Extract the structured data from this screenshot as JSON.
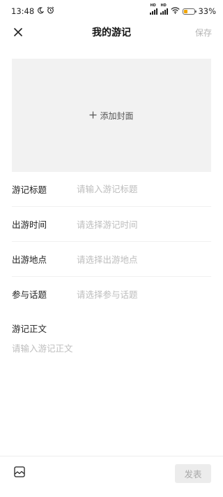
{
  "status_bar": {
    "time": "13:48",
    "battery_text": "33%",
    "battery_level": 0.33,
    "network_badge": "HD"
  },
  "header": {
    "title": "我的游记",
    "save_label": "保存"
  },
  "cover": {
    "add_label": "添加封面"
  },
  "form": {
    "title": {
      "label": "游记标题",
      "placeholder": "请输入游记标题"
    },
    "time": {
      "label": "出游时间",
      "placeholder": "请选择游记时间"
    },
    "place": {
      "label": "出游地点",
      "placeholder": "请选择出游地点"
    },
    "topic": {
      "label": "参与话题",
      "placeholder": "请选择参与话题"
    },
    "body": {
      "label": "游记正文",
      "placeholder": "请输入游记正文"
    }
  },
  "bottom_bar": {
    "publish_label": "发表"
  },
  "icons": {
    "close": "close-icon",
    "image": "image-icon",
    "moon": "moon-icon",
    "alarm": "alarm-icon",
    "wifi": "wifi-icon"
  }
}
